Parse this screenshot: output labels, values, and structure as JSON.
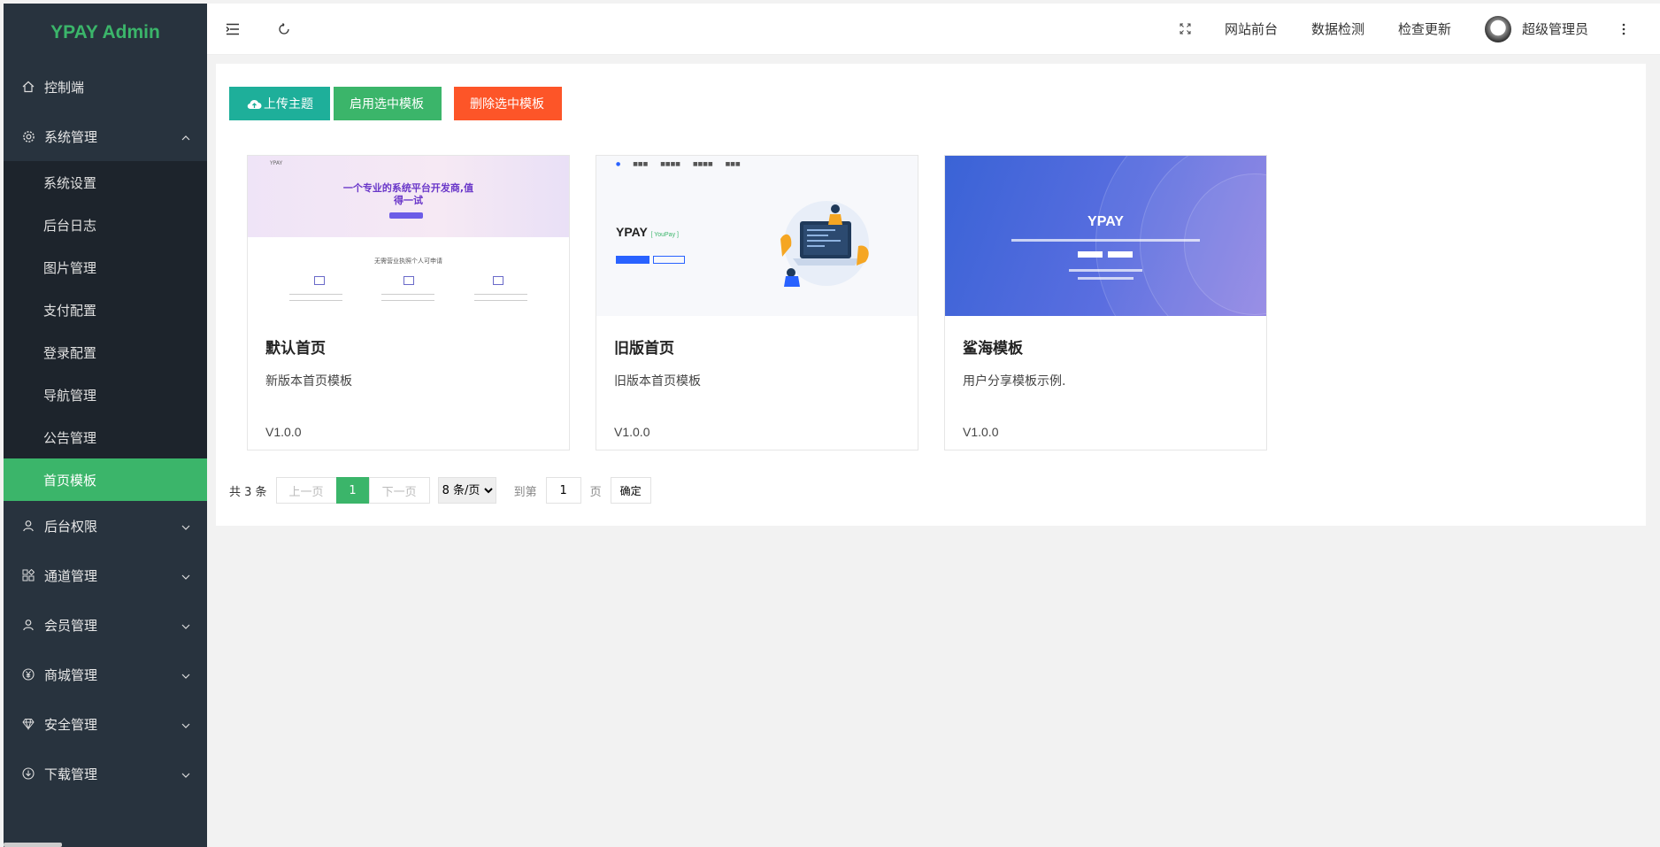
{
  "colors": {
    "accent": "#3bb56a",
    "sidebar": "#28333e",
    "submenu": "#1d242c",
    "upload": "#1eaf9a",
    "delete": "#fd5528"
  },
  "sidebar": {
    "logo": "YPAY Admin",
    "items": [
      {
        "label": "控制端",
        "icon": "home-icon"
      },
      {
        "label": "系统管理",
        "icon": "gear-icon",
        "expanded": true
      },
      {
        "label": "后台权限",
        "icon": "user-icon"
      },
      {
        "label": "通道管理",
        "icon": "apps-icon"
      },
      {
        "label": "会员管理",
        "icon": "user-icon"
      },
      {
        "label": "商城管理",
        "icon": "yen-icon"
      },
      {
        "label": "安全管理",
        "icon": "diamond-icon"
      },
      {
        "label": "下载管理",
        "icon": "download-icon"
      }
    ],
    "submenu": [
      "系统设置",
      "后台日志",
      "图片管理",
      "支付配置",
      "登录配置",
      "导航管理",
      "公告管理",
      "首页模板"
    ],
    "active_sub": "首页模板"
  },
  "header": {
    "links": [
      "网站前台",
      "数据检测",
      "检查更新"
    ],
    "user": "超级管理员"
  },
  "toolbar": {
    "upload": "上传主题",
    "enable": "启用选中模板",
    "delete": "删除选中模板"
  },
  "templates": [
    {
      "name": "默认首页",
      "desc": "新版本首页模板",
      "version": "V1.0.0",
      "thumb": {
        "brand": "YPAY",
        "headline1": "一个专业的系统平台开发商,值",
        "headline2": "得一试",
        "mid": "无需营业执照个人可申请"
      }
    },
    {
      "name": "旧版首页",
      "desc": "旧版本首页模板",
      "version": "V1.0.0",
      "thumb": {
        "brand": "YPAY",
        "tag": "[ YouPay ]"
      }
    },
    {
      "name": "鲨海模板",
      "desc": "用户分享模板示例.",
      "version": "V1.0.0",
      "thumb": {
        "brand": "YPAY"
      }
    }
  ],
  "pager": {
    "total": "共 3 条",
    "prev": "上一页",
    "current": "1",
    "next": "下一页",
    "page_size": "8 条/页",
    "goto_label": "到第",
    "goto_value": "1",
    "page_label": "页",
    "confirm": "确定"
  }
}
